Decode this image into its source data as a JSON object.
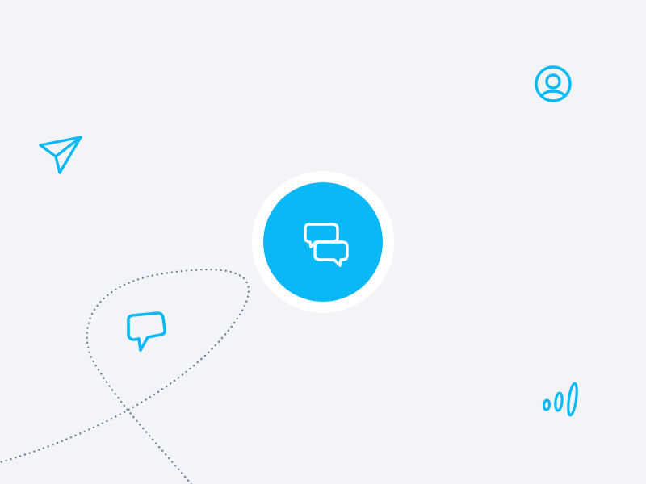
{
  "colors": {
    "background": "#f2f4f8",
    "accent": "#0bb8f6",
    "badge_ring": "#ffffff",
    "dotted_path": "#6f879c"
  },
  "icons": {
    "center": "chat-bubbles-icon",
    "top_left": "paper-plane-icon",
    "top_right": "user-avatar-icon",
    "bottom_left": "chat-bubble-icon",
    "bottom_right": "signal-bars-icon"
  }
}
